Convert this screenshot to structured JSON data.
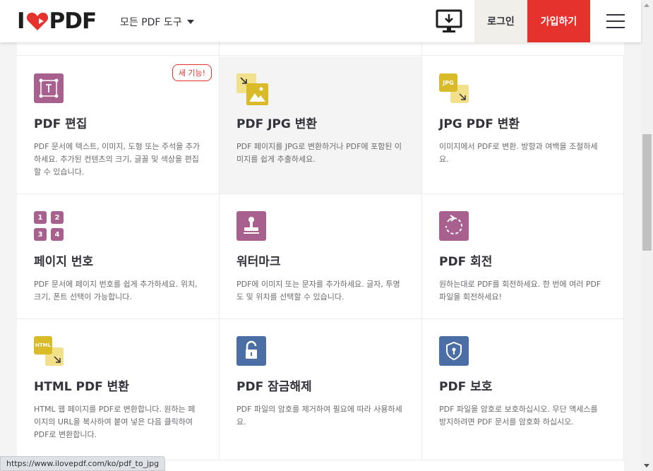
{
  "header": {
    "logo_left": "I",
    "logo_right": "PDF",
    "tools_menu_label": "모든 PDF 도구",
    "login_label": "로그인",
    "signup_label": "가입하기"
  },
  "colors": {
    "accent_red": "#e5322d",
    "purple": "#a8608f",
    "yellow": "#d9bb29",
    "blue": "#4b6fa5"
  },
  "tools": [
    {
      "title": "PDF 편집",
      "desc": "PDF 문서에 텍스트, 이미지, 도형 또는 주석을 추가하세요. 추가된 컨텐츠의 크기, 글꼴 및 색상을 편집할 수 있습니다.",
      "badge": "새 기능!",
      "icon": "edit-pdf-icon"
    },
    {
      "title": "PDF JPG 변환",
      "desc": "PDF 페이지를 JPG로 변환하거나 PDF에 포함된 이미지를 쉽게 추출하세요.",
      "icon": "pdf-to-jpg-icon"
    },
    {
      "title": "JPG PDF 변환",
      "desc": "이미지에서 PDF로 변환. 방향과 여백을 조절하세요.",
      "icon": "jpg-to-pdf-icon",
      "icon_text": "JPG"
    },
    {
      "title": "페이지 번호",
      "desc": "PDF 문서에 페이지 번호를 쉽게 추가하세요. 위치, 크기, 폰트 선택이 가능합니다.",
      "icon": "page-numbers-icon",
      "numbers": [
        "1",
        "2",
        "3",
        "4"
      ]
    },
    {
      "title": "워터마크",
      "desc": "PDF에 이미지 또는 문자를 추가하세요. 글자, 투명도 및 위치를 선택할 수 있습니다.",
      "icon": "watermark-stamp-icon"
    },
    {
      "title": "PDF 회전",
      "desc": "원하는대로 PDF를 회전하세요. 한 번에 여러 PDF 파일을 회전하세요!",
      "icon": "rotate-icon"
    },
    {
      "title": "HTML PDF 변환",
      "desc": "HTML 웹 페이지를 PDF로 변환합니다. 원하는 페이지의 URL을 복사하여 붙여 넣은 다음 클릭하여 PDF로 변환합니다.",
      "icon": "html-to-pdf-icon",
      "icon_text": "HTML"
    },
    {
      "title": "PDF 잠금해제",
      "desc": "PDF 파일의 암호를 제거하여 필요에 따라 사용하세요.",
      "icon": "unlock-icon"
    },
    {
      "title": "PDF 보호",
      "desc": "PDF 파일을 암호로 보호하십시오. 무단 액세스를 방지하려면 PDF 문서를 암호화 하십시오.",
      "icon": "shield-lock-icon"
    }
  ],
  "status_bar": {
    "url": "https://www.ilovepdf.com/ko/pdf_to_jpg"
  }
}
